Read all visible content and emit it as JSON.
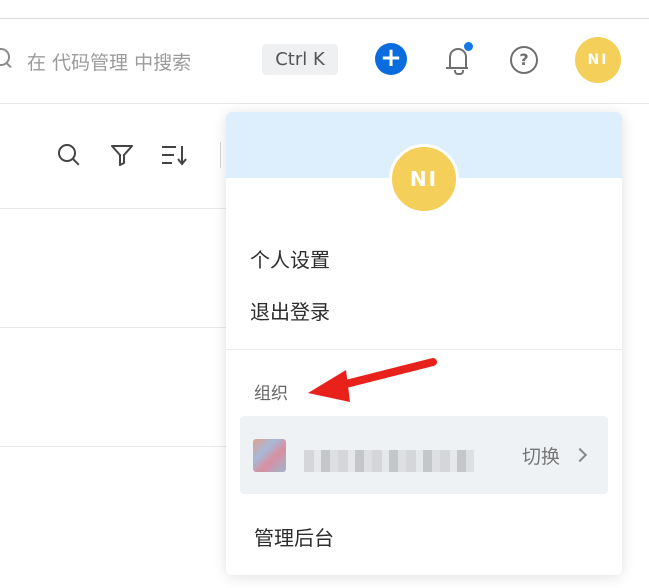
{
  "header": {
    "search_placeholder": "在 代码管理 中搜索",
    "shortcut": "Ctrl K",
    "add_label": "+",
    "help_label": "?",
    "avatar_initials": "NI"
  },
  "dropdown": {
    "avatar_initials": "NI",
    "personal_settings": "个人设置",
    "logout": "退出登录",
    "org_section_label": "组织",
    "org_name": "",
    "switch_label": "切换",
    "admin": "管理后台"
  },
  "colors": {
    "accent": "#0a6cde",
    "avatar": "#f4cf5a",
    "dropdown_header": "#ddeefc",
    "notification_dot": "#1677e6",
    "annotation_arrow": "#e8211b"
  }
}
